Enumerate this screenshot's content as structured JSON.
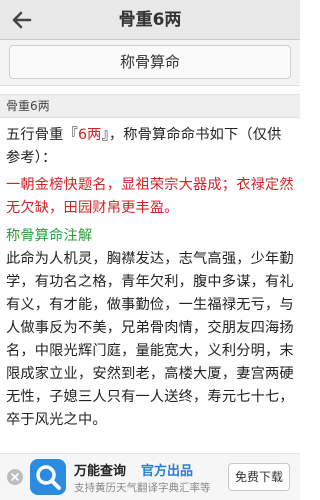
{
  "header": {
    "title": "骨重6两",
    "back_icon": "arrow-left-icon"
  },
  "toolbar": {
    "calc_button_label": "称骨算命"
  },
  "section": {
    "heading": "骨重6两"
  },
  "article": {
    "intro_prefix": "五行骨重『",
    "intro_weight": "6两",
    "intro_suffix": "』，称骨算命命书如下（仅供参考）：",
    "verse": "一朝金榜快题名，显祖荣宗大器成；衣禄定然无欠缺，田园财帛更丰盈。",
    "note_title": "称骨算命注解",
    "note_body": "此命为人机灵，胸襟发达，志气高强，少年勤学，有功名之格，青年欠利，腹中多谋，有礼有义，有才能，做事勤俭，一生福禄无亏，与人做事反为不美，兄弟骨肉情，交朋友四海扬名，中限光辉门庭，量能宽大，义利分明，末限成家立业，安然到老，高楼大厦，妻宫两硬无性，子媳三人只有一人送终，寿元七十七，卒于风光之中。"
  },
  "ad": {
    "app_name": "万能查询",
    "tag": "官方出品",
    "description": "支持黄历天气翻译字典汇率等",
    "download_label": "免费下载",
    "close_icon": "close-icon",
    "logo_icon": "magnifier-logo-icon"
  },
  "colors": {
    "highlight": "#d0242b",
    "note_title": "#2f9d3e",
    "ad_accent": "#2a7fd4"
  }
}
